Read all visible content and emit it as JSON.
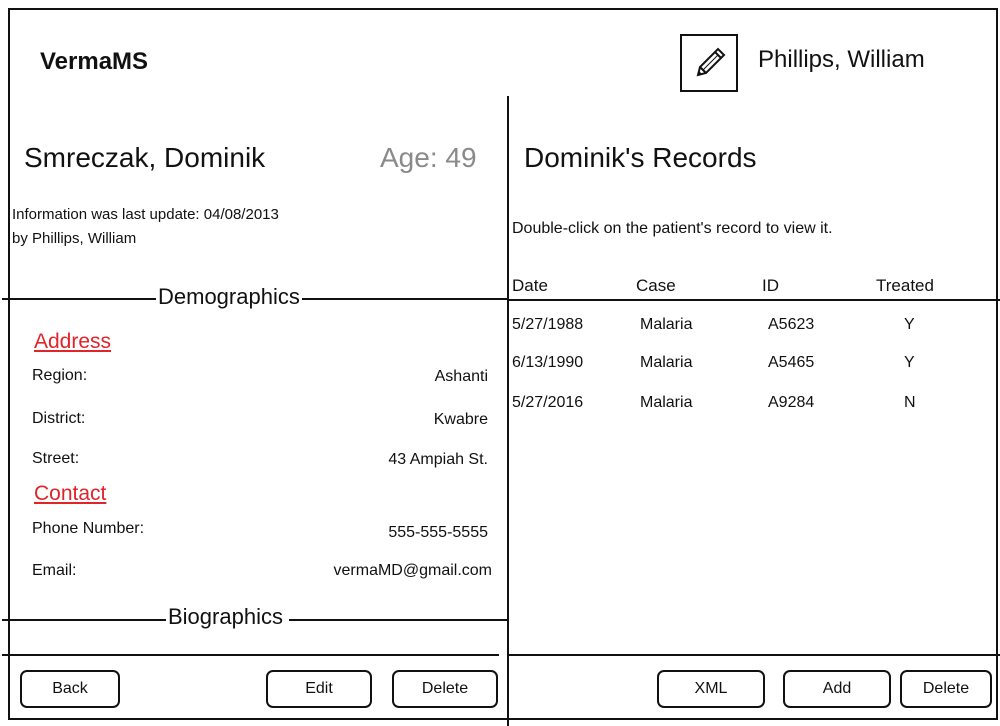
{
  "header": {
    "app_title": "VermaMS",
    "edit_icon": "pencil-icon",
    "user_name": "Phillips, William"
  },
  "patient": {
    "name": "Smreczak, Dominik",
    "age": "Age: 49",
    "updated_line": "Information was last update: 04/08/2013",
    "updated_by": "by Phillips, William"
  },
  "demographics": {
    "title": "Demographics",
    "address_heading": "Address",
    "contact_heading": "Contact",
    "fields": [
      {
        "label": "Region:",
        "value": "Ashanti"
      },
      {
        "label": "District:",
        "value": "Kwabre"
      },
      {
        "label": "Street:",
        "value": "43 Ampiah St."
      },
      {
        "label": "Phone Number:",
        "value": "555-555-5555"
      },
      {
        "label": "Email:",
        "value": "vermaMD@gmail.com"
      }
    ]
  },
  "biographics": {
    "title": "Biographics"
  },
  "records": {
    "title": "Dominik's Records",
    "hint": "Double-click on the patient's record to view it.",
    "columns": [
      "Date",
      "Case",
      "ID",
      "Treated"
    ],
    "rows": [
      {
        "date": "5/27/1988",
        "case": "Malaria",
        "id": "A5623",
        "treated": "Y"
      },
      {
        "date": "6/13/1990",
        "case": "Malaria",
        "id": "A5465",
        "treated": "Y"
      },
      {
        "date": "5/27/2016",
        "case": "Malaria",
        "id": "A9284",
        "treated": "N"
      }
    ]
  },
  "buttons": {
    "back": "Back",
    "edit": "Edit",
    "delete_patient": "Delete",
    "xml": "XML",
    "add": "Add",
    "delete_record": "Delete"
  },
  "colors": {
    "accent_red": "#e0242a",
    "muted_gray": "#8a8a8a"
  }
}
